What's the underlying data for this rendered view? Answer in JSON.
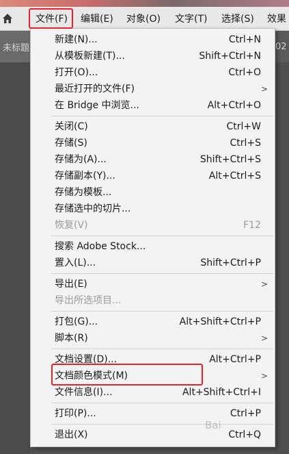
{
  "menubar": {
    "items": [
      "文件(F)",
      "编辑(E)",
      "对象(O)",
      "文字(T)",
      "选择(S)",
      "效果"
    ]
  },
  "doc_tab": {
    "title": "未标题",
    "right_text": "02"
  },
  "file_menu": {
    "items": [
      {
        "label": "新建(N)...",
        "shortcut": "Ctrl+N"
      },
      {
        "label": "从模板新建(T)...",
        "shortcut": "Shift+Ctrl+N"
      },
      {
        "label": "打开(O)...",
        "shortcut": "Ctrl+O"
      },
      {
        "label": "最近打开的文件(F)",
        "shortcut": ""
      },
      {
        "label": "在 Bridge 中浏览...",
        "shortcut": "Alt+Ctrl+O"
      },
      {
        "label": "关闭(C)",
        "shortcut": "Ctrl+W"
      },
      {
        "label": "存储(S)",
        "shortcut": "Ctrl+S"
      },
      {
        "label": "存储为(A)...",
        "shortcut": "Shift+Ctrl+S"
      },
      {
        "label": "存储副本(Y)...",
        "shortcut": "Alt+Ctrl+S"
      },
      {
        "label": "存储为模板...",
        "shortcut": ""
      },
      {
        "label": "存储选中的切片...",
        "shortcut": ""
      },
      {
        "label": "恢复(V)",
        "shortcut": "F12"
      },
      {
        "label": "搜索 Adobe Stock...",
        "shortcut": ""
      },
      {
        "label": "置入(L)...",
        "shortcut": "Shift+Ctrl+P"
      },
      {
        "label": "导出(E)",
        "shortcut": ""
      },
      {
        "label": "导出所选项目...",
        "shortcut": ""
      },
      {
        "label": "打包(G)...",
        "shortcut": "Alt+Shift+Ctrl+P"
      },
      {
        "label": "脚本(R)",
        "shortcut": ""
      },
      {
        "label": "文档设置(D)...",
        "shortcut": "Alt+Ctrl+P"
      },
      {
        "label": "文档颜色模式(M)",
        "shortcut": ""
      },
      {
        "label": "文件信息(I)...",
        "shortcut": "Alt+Shift+Ctrl+I"
      },
      {
        "label": "打印(P)...",
        "shortcut": "Ctrl+P"
      },
      {
        "label": "退出(X)",
        "shortcut": "Ctrl+Q"
      }
    ]
  },
  "colors": {
    "highlight": "#e8222a",
    "menu_bg": "#f3f3f3",
    "disabled_text": "#9a9a9a"
  },
  "icons": {
    "home": "home-icon",
    "submenu": "chevron-right-icon"
  },
  "watermark": "Bai"
}
